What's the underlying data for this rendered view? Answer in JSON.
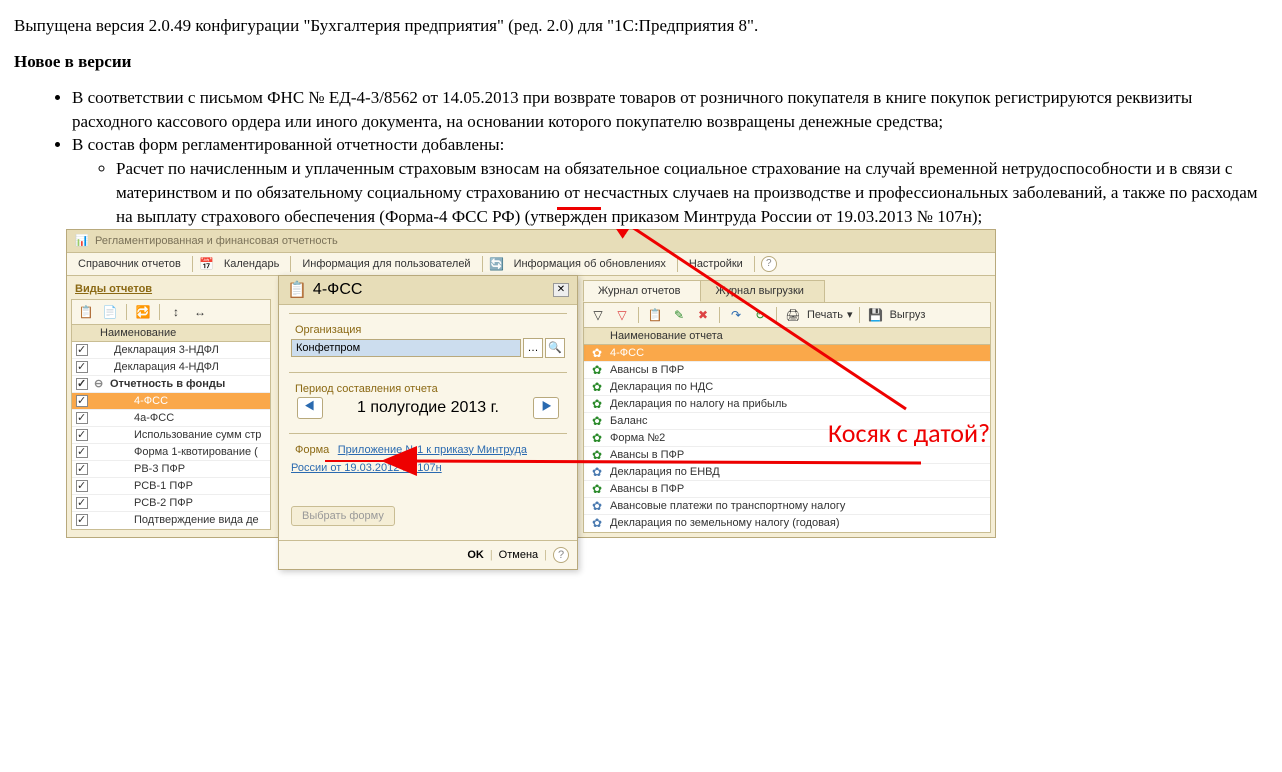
{
  "article": {
    "intro": "Выпущена версия 2.0.49 конфигурации \"Бухгалтерия предприятия\" (ред. 2.0) для \"1С:Предприятия 8\".",
    "h3": "Новое в версии",
    "li1": "В соответствии с письмом ФНС № ЕД-4-3/8562 от 14.05.2013 при возврате товаров от розничного покупателя в книге покупок регистрируются реквизиты расходного кассового ордера или иного документа, на основании которого покупателю возвращены денежные средства;",
    "li2": "В состав форм регламентированной отчетности добавлены:",
    "li2a": "Расчет по начисленным и уплаченным страховым взносам на обязательное социальное страхование на случай временной нетрудоспособности и в связи с материнством и по обязательному социальному страхованию от несчастных случаев на производстве и профессиональных заболеваний, а также по расходам на выплату страхового обеспечения (Форма-4 ФСС РФ) (утвержден приказом Минтруда России от 19.03.2013 № 107н);"
  },
  "window_title": "Регламентированная и финансовая отчетность",
  "topbar": {
    "i1": "Справочник отчетов",
    "i2": "Календарь",
    "i3": "Информация для пользователей",
    "i4": "Информация об обновлениях",
    "i5": "Настройки"
  },
  "left": {
    "title": "Виды отчетов",
    "col": "Наименование",
    "rows": [
      "Декларация 3-НДФЛ",
      "Декларация 4-НДФЛ",
      "Отчетность в фонды",
      "4-ФСС",
      "4а-ФСС",
      "Использование сумм стр",
      "Форма 1-квотирование (",
      "РВ-3 ПФР",
      "РСВ-1 ПФР",
      "РСВ-2 ПФР",
      "Подтверждение вида де"
    ]
  },
  "dialog": {
    "title": "4-ФСС",
    "fs_org": "Организация",
    "org_value": "Конфетпром",
    "fs_period": "Период составления отчета",
    "period_value": "1 полугодие 2013 г.",
    "fs_form": "Форма",
    "form_link": "Приложение №1 к приказу Минтруда России от 19.03.2012 № 107н",
    "choose_form": "Выбрать форму",
    "ok": "OK",
    "cancel": "Отмена"
  },
  "right": {
    "tab1": "Журнал отчетов",
    "tab2": "Журнал выгрузки",
    "print": "Печать",
    "export": "Выгруз",
    "col": "Наименование отчета",
    "rows": [
      {
        "t": "4-ФСС",
        "c": "white",
        "sel": true
      },
      {
        "t": "Авансы в ПФР",
        "c": "green"
      },
      {
        "t": "Декларация по НДС",
        "c": "green"
      },
      {
        "t": "Декларация по налогу на прибыль",
        "c": "green"
      },
      {
        "t": "Баланс",
        "c": "green"
      },
      {
        "t": "Форма №2",
        "c": "green"
      },
      {
        "t": "Авансы в ПФР",
        "c": "green"
      },
      {
        "t": "Декларация по ЕНВД",
        "c": "blue"
      },
      {
        "t": "Авансы в ПФР",
        "c": "green"
      },
      {
        "t": "Авансовые платежи по транспортному налогу",
        "c": "blue"
      },
      {
        "t": "Декларация по земельному налогу (годовая)",
        "c": "blue"
      }
    ]
  },
  "annotation": "Косяк с датой?"
}
